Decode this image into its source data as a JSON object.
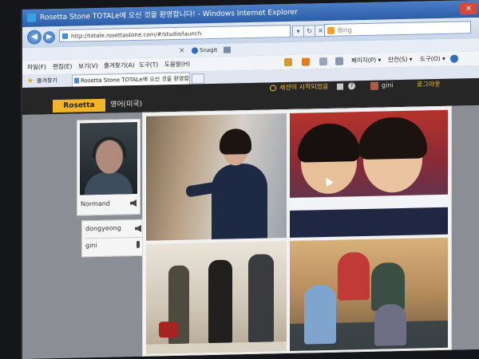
{
  "browser": {
    "window_title": "Rosetta Stone TOTALe에 오신 것을 환영합니다! - Windows Internet Explorer",
    "address": "http://totale.rosettastone.com/#/studio/launch",
    "search_placeholder": "Bing",
    "toolbar": {
      "close_glyph": "×",
      "snagit_label": "SnagIt"
    },
    "menu": [
      "파일(F)",
      "편집(E)",
      "보기(V)",
      "즐겨찾기(A)",
      "도구(T)",
      "도움말(H)"
    ],
    "tools_right": [
      "페이지(P) ▾",
      "안전(S) ▾",
      "도구(O) ▾"
    ],
    "favorites_label": "즐겨찾기",
    "tab_title": "Rosetta Stone TOTALe에 오신 것을 환영합니다!"
  },
  "app": {
    "session_label": "세션이 시작되었음",
    "user_name": "gini",
    "logout_label": "로그아웃",
    "help_glyph": "?",
    "logo_text": "Rosetta Stone",
    "language_label": "영어(미국)"
  },
  "video": {
    "name": "Normand"
  },
  "participants": [
    {
      "name": "dongyeong"
    },
    {
      "name": "gini"
    }
  ],
  "icons": {
    "favorites_star": "★",
    "back": "◀",
    "forward": "▶"
  },
  "colors": {
    "logo": "#f1b52a",
    "session_accent": "#f4c33a",
    "header_bg": "#262626"
  }
}
